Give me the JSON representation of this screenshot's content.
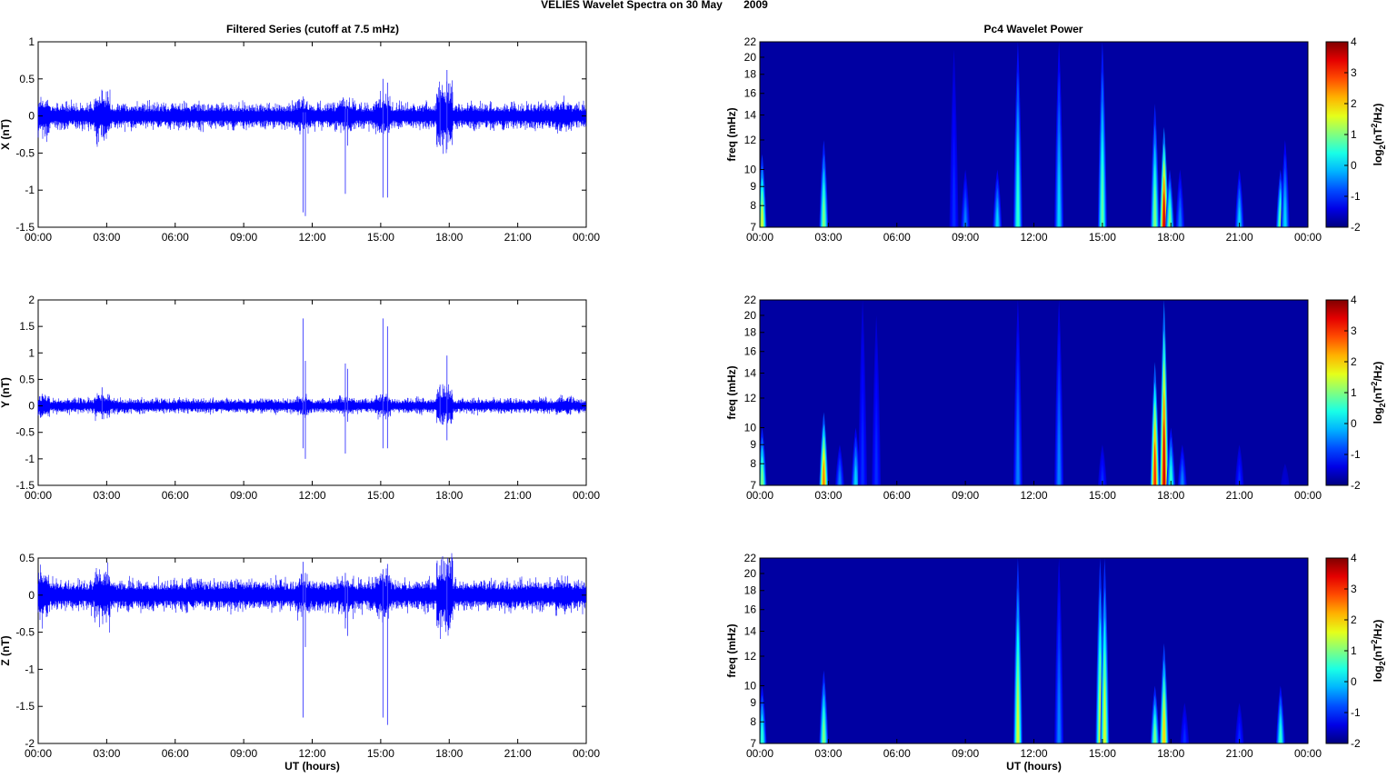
{
  "chart_data": {
    "type": "line+heatmap",
    "title": "VELIES Wavelet Spectra on 30 May       2009",
    "left_title": "Filtered Series (cutoff at 7.5 mHz)",
    "right_title": "Pc4 Wavelet Power",
    "xlabel": "UT (hours)",
    "xticks": [
      "00:00",
      "03:00",
      "06:00",
      "09:00",
      "12:00",
      "15:00",
      "18:00",
      "21:00",
      "00:00"
    ],
    "xlim": [
      0,
      24
    ],
    "series": [
      {
        "name": "X",
        "ylabel": "X (nT)",
        "ylim": [
          -1.5,
          1
        ],
        "yticks": [
          "-1.5",
          "-1",
          "-0.5",
          "0",
          "0.5",
          "1"
        ],
        "yvals": [
          -1.5,
          -1,
          -0.5,
          0,
          0.5,
          1
        ],
        "noise_amplitude": 0.1,
        "spikes": [
          [
            11.6,
            0.05,
            -1.3
          ],
          [
            11.7,
            0.05,
            -1.35
          ],
          [
            13.45,
            0.1,
            -1.05
          ],
          [
            13.55,
            0.1,
            -0.4
          ],
          [
            15.1,
            0.5,
            -1.1
          ],
          [
            15.3,
            0.45,
            -1.1
          ],
          [
            17.9,
            0.62,
            -0.45
          ],
          [
            17.6,
            0.35,
            -0.3
          ]
        ]
      },
      {
        "name": "Y",
        "ylabel": "Y (nT)",
        "ylim": [
          -1.5,
          2
        ],
        "yticks": [
          "-1.5",
          "-1",
          "-0.5",
          "0",
          "0.5",
          "1",
          "1.5",
          "2"
        ],
        "yvals": [
          -1.5,
          -1,
          -0.5,
          0,
          0.5,
          1,
          1.5,
          2
        ],
        "noise_amplitude": 0.08,
        "spikes": [
          [
            11.6,
            1.65,
            -0.8
          ],
          [
            11.7,
            0.85,
            -1.0
          ],
          [
            13.45,
            0.8,
            -0.9
          ],
          [
            13.55,
            0.7,
            -0.3
          ],
          [
            15.1,
            1.65,
            -0.8
          ],
          [
            15.3,
            1.5,
            -0.8
          ],
          [
            17.9,
            0.95,
            -0.65
          ],
          [
            17.6,
            0.4,
            -0.3
          ],
          [
            2.8,
            0.35,
            -0.25
          ]
        ]
      },
      {
        "name": "Z",
        "ylabel": "Z (nT)",
        "ylim": [
          -2,
          0.5
        ],
        "yticks": [
          "-2",
          "-1.5",
          "-1",
          "-0.5",
          "0",
          "0.5"
        ],
        "yvals": [
          -2,
          -1.5,
          -1,
          -0.5,
          0,
          0.5
        ],
        "noise_amplitude": 0.12,
        "spikes": [
          [
            11.6,
            0.45,
            -1.65
          ],
          [
            11.7,
            0.3,
            -0.7
          ],
          [
            13.45,
            0.3,
            -0.45
          ],
          [
            13.55,
            0.2,
            -0.55
          ],
          [
            15.1,
            0.35,
            -1.65
          ],
          [
            15.3,
            0.42,
            -1.75
          ],
          [
            17.9,
            0.35,
            -0.3
          ]
        ]
      }
    ],
    "wavelet": {
      "ylabel": "freq (mHz)",
      "yticks": [
        7,
        8,
        9,
        10,
        12,
        14,
        16,
        18,
        20,
        22
      ],
      "ylim": [
        7,
        22
      ],
      "yscale": "log",
      "colorbar": {
        "label": "log2(nT2/Hz)",
        "label_main": "log",
        "label_sub": "2",
        "label_rest": "(nT",
        "label_sup": "2",
        "label_end": "/Hz)",
        "range": [
          -2,
          4
        ],
        "ticks": [
          "4",
          "3",
          "2",
          "1",
          "0",
          "-1",
          "-2"
        ],
        "tickvals": [
          4,
          3,
          2,
          1,
          0,
          -1,
          -2
        ]
      },
      "panels": [
        {
          "component": "X",
          "events": [
            [
              0.1,
              11,
              1.5
            ],
            [
              2.8,
              12,
              1
            ],
            [
              9.0,
              10,
              -0.5
            ],
            [
              10.4,
              10,
              0
            ],
            [
              8.5,
              21,
              -1
            ],
            [
              11.3,
              22,
              0.5
            ],
            [
              13.1,
              22,
              0
            ],
            [
              15.0,
              22,
              0.8
            ],
            [
              17.3,
              15,
              1
            ],
            [
              17.7,
              13,
              3.5
            ],
            [
              17.95,
              10,
              1
            ],
            [
              18.4,
              10,
              -0.5
            ],
            [
              21.0,
              10,
              0
            ],
            [
              22.8,
              10,
              1
            ],
            [
              23.0,
              12,
              0
            ]
          ]
        },
        {
          "component": "Y",
          "events": [
            [
              0.1,
              10,
              1
            ],
            [
              2.8,
              11,
              2.5
            ],
            [
              3.5,
              9,
              -0.5
            ],
            [
              4.2,
              10,
              0
            ],
            [
              4.5,
              22,
              -1
            ],
            [
              5.1,
              20,
              -1
            ],
            [
              11.3,
              22,
              -0.5
            ],
            [
              13.1,
              22,
              -0.5
            ],
            [
              15.0,
              9,
              -1
            ],
            [
              17.3,
              15,
              3
            ],
            [
              17.7,
              22,
              3.5
            ],
            [
              18.0,
              10,
              0.5
            ],
            [
              18.5,
              9,
              -0.5
            ],
            [
              21.0,
              9,
              -1
            ],
            [
              23.0,
              8,
              -1.5
            ]
          ]
        },
        {
          "component": "Z",
          "events": [
            [
              0.1,
              10,
              0.5
            ],
            [
              2.8,
              11,
              1
            ],
            [
              11.3,
              22,
              1.5
            ],
            [
              13.1,
              22,
              -0.5
            ],
            [
              14.9,
              22,
              1.5
            ],
            [
              15.1,
              22,
              1.5
            ],
            [
              17.3,
              10,
              1
            ],
            [
              17.7,
              13,
              2
            ],
            [
              18.6,
              9,
              -1
            ],
            [
              21.0,
              9,
              -1
            ],
            [
              22.8,
              10,
              0.5
            ]
          ]
        }
      ]
    },
    "colors": {
      "line": "#0000ff",
      "background": "#00008f"
    }
  }
}
